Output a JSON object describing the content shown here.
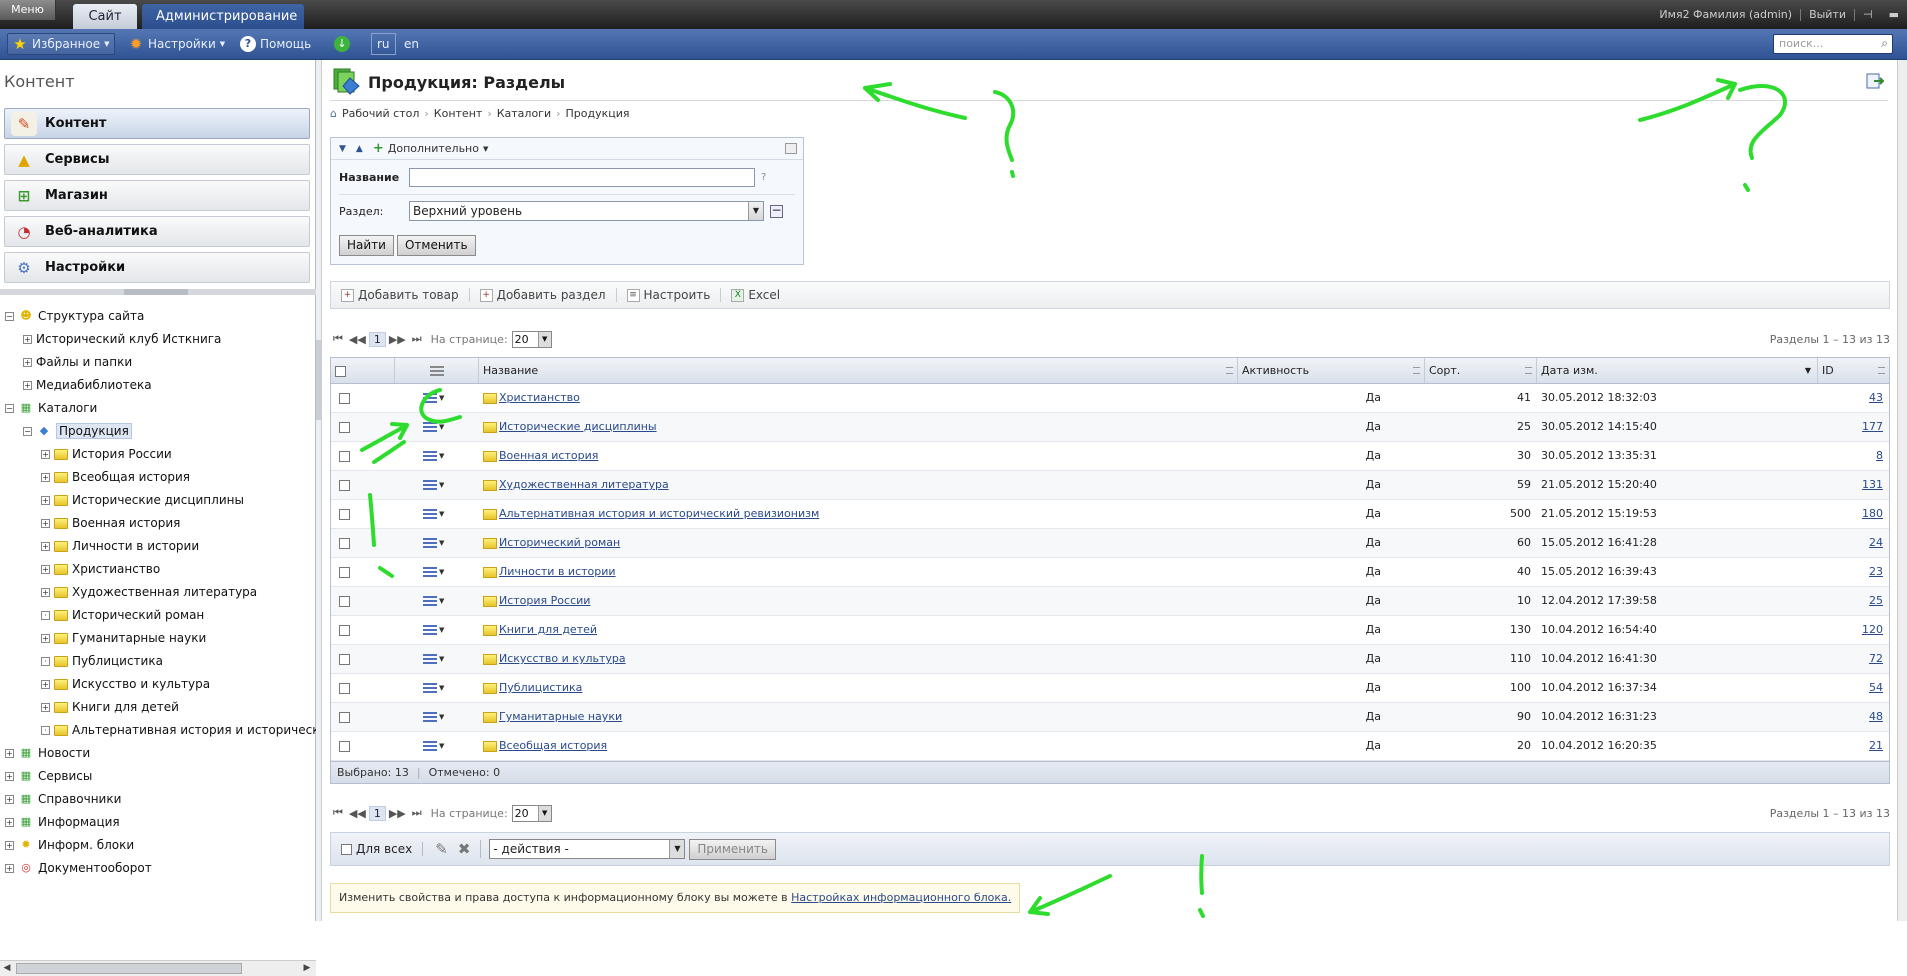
{
  "topbar": {
    "menu_label": "Меню",
    "tab_site": "Сайт",
    "tab_admin": "Администрирование",
    "user": "Имя2 Фамилия (admin)",
    "logout": "Выйти"
  },
  "toolbar": {
    "favorites": "Избранное",
    "settings": "Настройки",
    "help": "Помощь",
    "lang_ru": "ru",
    "lang_en": "en",
    "search_placeholder": "поиск..."
  },
  "sidebar": {
    "title": "Контент",
    "menu": [
      {
        "label": "Контент",
        "icon": "pencil-icon"
      },
      {
        "label": "Сервисы",
        "icon": "shapes-icon"
      },
      {
        "label": "Магазин",
        "icon": "cart-icon"
      },
      {
        "label": "Веб-аналитика",
        "icon": "chart-icon"
      },
      {
        "label": "Настройки",
        "icon": "gear-icon"
      }
    ],
    "tree": [
      {
        "label": "Структура сайта",
        "level": 0,
        "exp": "−",
        "icon": "sitemap-icon"
      },
      {
        "label": "Исторический клуб Исткнига",
        "level": 1,
        "exp": "+",
        "icon": "none"
      },
      {
        "label": "Файлы и папки",
        "level": 1,
        "exp": "+",
        "icon": "none"
      },
      {
        "label": "Медиабиблиотека",
        "level": 1,
        "exp": "+",
        "icon": "none"
      },
      {
        "label": "Каталоги",
        "level": 0,
        "exp": "−",
        "icon": "catalog-icon"
      },
      {
        "label": "Продукция",
        "level": 1,
        "exp": "−",
        "icon": "iblock-icon",
        "selected": true
      },
      {
        "label": "История России",
        "level": 2,
        "exp": "+",
        "icon": "folder"
      },
      {
        "label": "Всеобщая история",
        "level": 2,
        "exp": "+",
        "icon": "folder"
      },
      {
        "label": "Исторические дисциплины",
        "level": 2,
        "exp": "+",
        "icon": "folder"
      },
      {
        "label": "Военная история",
        "level": 2,
        "exp": "+",
        "icon": "folder"
      },
      {
        "label": "Личности в истории",
        "level": 2,
        "exp": "+",
        "icon": "folder"
      },
      {
        "label": "Христианство",
        "level": 2,
        "exp": "+",
        "icon": "folder"
      },
      {
        "label": "Художественная литература",
        "level": 2,
        "exp": "+",
        "icon": "folder"
      },
      {
        "label": "Исторический роман",
        "level": 2,
        "exp": "·",
        "icon": "folder"
      },
      {
        "label": "Гуманитарные науки",
        "level": 2,
        "exp": "+",
        "icon": "folder"
      },
      {
        "label": "Публицистика",
        "level": 2,
        "exp": "·",
        "icon": "folder"
      },
      {
        "label": "Искусство и культура",
        "level": 2,
        "exp": "+",
        "icon": "folder"
      },
      {
        "label": "Книги для детей",
        "level": 2,
        "exp": "+",
        "icon": "folder"
      },
      {
        "label": "Альтернативная история и исторический",
        "level": 2,
        "exp": "·",
        "icon": "folder"
      },
      {
        "label": "Новости",
        "level": 0,
        "exp": "+",
        "icon": "catalog-icon"
      },
      {
        "label": "Сервисы",
        "level": 0,
        "exp": "+",
        "icon": "catalog-icon"
      },
      {
        "label": "Справочники",
        "level": 0,
        "exp": "+",
        "icon": "catalog-icon"
      },
      {
        "label": "Информация",
        "level": 0,
        "exp": "+",
        "icon": "catalog-icon"
      },
      {
        "label": "Информ. блоки",
        "level": 0,
        "exp": "+",
        "icon": "iblocks-icon"
      },
      {
        "label": "Документооборот",
        "level": 0,
        "exp": "+",
        "icon": "workflow-icon"
      }
    ]
  },
  "main": {
    "title": "Продукция: Разделы",
    "breadcrumb": [
      "Рабочий стол",
      "Контент",
      "Каталоги",
      "Продукция"
    ],
    "filter": {
      "more": "Дополнительно",
      "name_label": "Название",
      "name_value": "",
      "help": "?",
      "section_label": "Раздел:",
      "section_value": "Верхний уровень",
      "find": "Найти",
      "cancel": "Отменить"
    },
    "actions": {
      "add_product": "Добавить товар",
      "add_section": "Добавить раздел",
      "configure": "Настроить",
      "excel": "Excel"
    },
    "pager": {
      "page": "1",
      "per_page_label": "На странице:",
      "per_page": "20",
      "summary": "Разделы 1 – 13 из 13"
    },
    "table": {
      "columns": [
        "Название",
        "Активность",
        "Сорт.",
        "Дата изм.",
        "ID"
      ],
      "rows": [
        {
          "name": "Христианство",
          "active": "Да",
          "sort": "41",
          "date": "30.05.2012 18:32:03",
          "id": "43"
        },
        {
          "name": "Исторические дисциплины",
          "active": "Да",
          "sort": "25",
          "date": "30.05.2012 14:15:40",
          "id": "177"
        },
        {
          "name": "Военная история",
          "active": "Да",
          "sort": "30",
          "date": "30.05.2012 13:35:31",
          "id": "8"
        },
        {
          "name": "Художественная литература",
          "active": "Да",
          "sort": "59",
          "date": "21.05.2012 15:20:40",
          "id": "131"
        },
        {
          "name": "Альтернативная история и исторический ревизионизм",
          "active": "Да",
          "sort": "500",
          "date": "21.05.2012 15:19:53",
          "id": "180"
        },
        {
          "name": "Исторический роман",
          "active": "Да",
          "sort": "60",
          "date": "15.05.2012 16:41:28",
          "id": "24"
        },
        {
          "name": "Личности в истории",
          "active": "Да",
          "sort": "40",
          "date": "15.05.2012 16:39:43",
          "id": "23"
        },
        {
          "name": "История России",
          "active": "Да",
          "sort": "10",
          "date": "12.04.2012 17:39:58",
          "id": "25"
        },
        {
          "name": "Книги для детей",
          "active": "Да",
          "sort": "130",
          "date": "10.04.2012 16:54:40",
          "id": "120"
        },
        {
          "name": "Искусство и культура",
          "active": "Да",
          "sort": "110",
          "date": "10.04.2012 16:41:30",
          "id": "72"
        },
        {
          "name": "Публицистика",
          "active": "Да",
          "sort": "100",
          "date": "10.04.2012 16:37:34",
          "id": "54"
        },
        {
          "name": "Гуманитарные науки",
          "active": "Да",
          "sort": "90",
          "date": "10.04.2012 16:31:23",
          "id": "48"
        },
        {
          "name": "Всеобщая история",
          "active": "Да",
          "sort": "20",
          "date": "10.04.2012 16:20:35",
          "id": "21"
        }
      ],
      "footer_selected": "Выбрано: 13",
      "footer_checked": "Отмечено: 0"
    },
    "group": {
      "for_all": "Для всех",
      "actions_value": "- действия -",
      "apply": "Применить"
    },
    "note": {
      "text": "Изменить свойства и права доступа к информационному блоку вы можете в",
      "link": "Настройках информационного блока."
    }
  },
  "colors": {
    "annotation": "#2edc2e",
    "toolbar_blue": "#3a5fa0"
  }
}
